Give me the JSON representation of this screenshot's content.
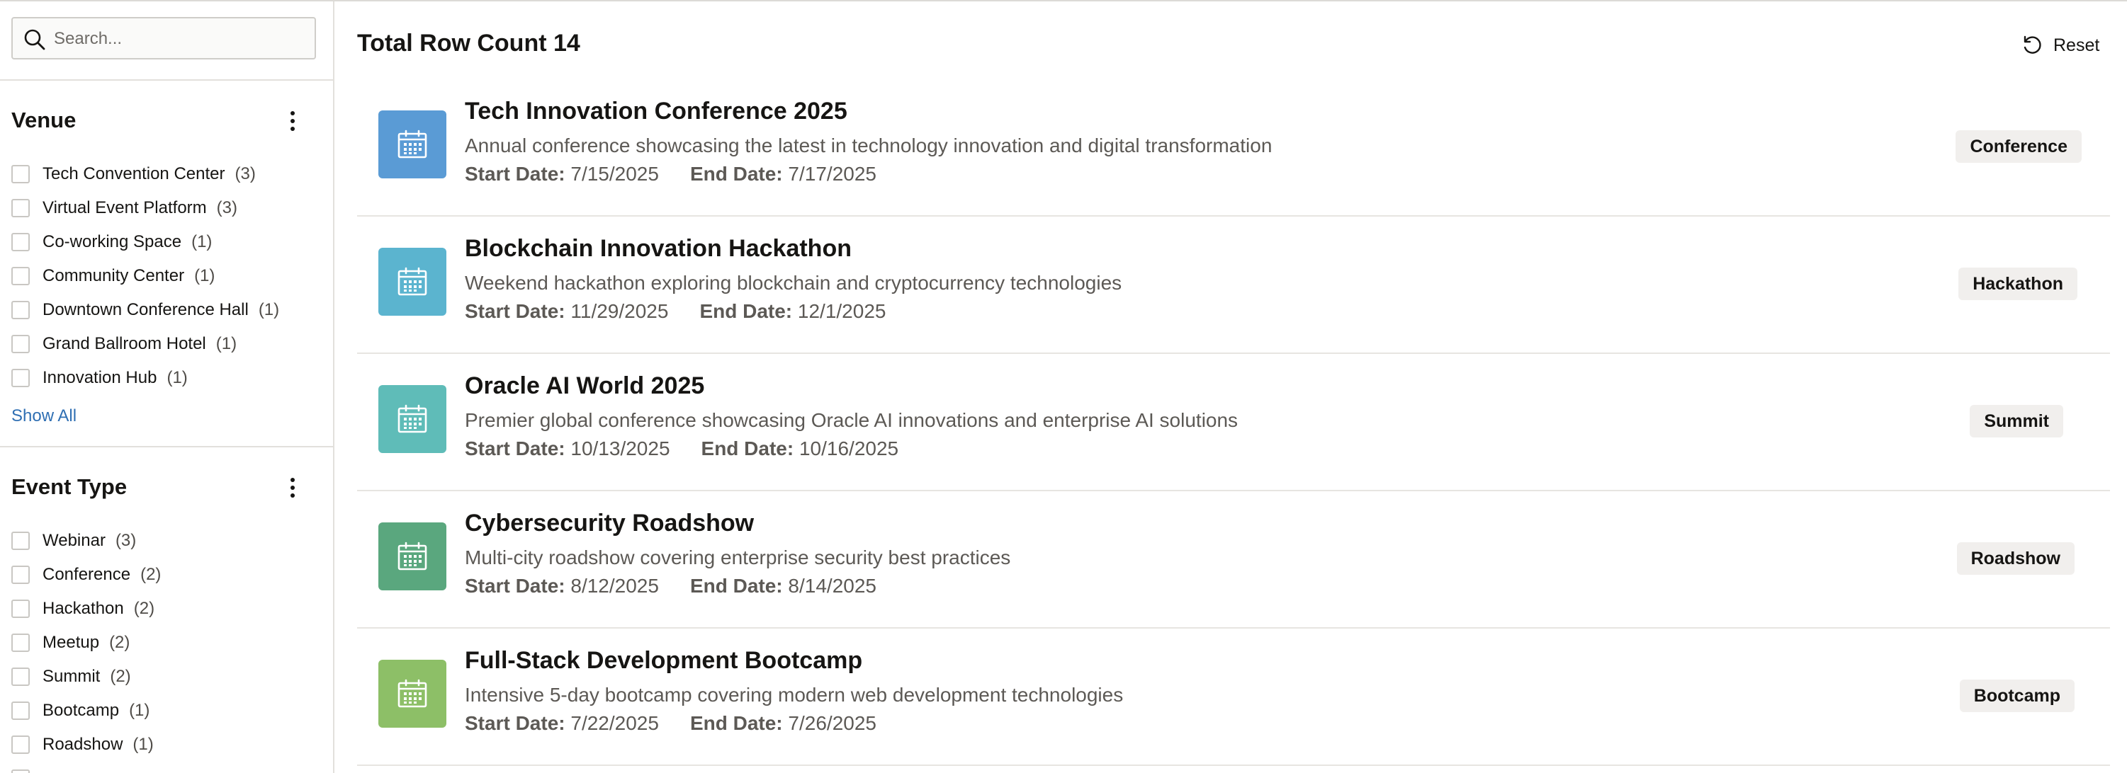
{
  "search": {
    "placeholder": "Search...",
    "value": ""
  },
  "facets": {
    "venue": {
      "title": "Venue",
      "options": [
        {
          "label": "Tech Convention Center",
          "count": "(3)"
        },
        {
          "label": "Virtual Event Platform",
          "count": "(3)"
        },
        {
          "label": "Co-working Space",
          "count": "(1)"
        },
        {
          "label": "Community Center",
          "count": "(1)"
        },
        {
          "label": "Downtown Conference Hall",
          "count": "(1)"
        },
        {
          "label": "Grand Ballroom Hotel",
          "count": "(1)"
        },
        {
          "label": "Innovation Hub",
          "count": "(1)"
        }
      ],
      "show_all": "Show All"
    },
    "event_type": {
      "title": "Event Type",
      "options": [
        {
          "label": "Webinar",
          "count": "(3)"
        },
        {
          "label": "Conference",
          "count": "(2)"
        },
        {
          "label": "Hackathon",
          "count": "(2)"
        },
        {
          "label": "Meetup",
          "count": "(2)"
        },
        {
          "label": "Summit",
          "count": "(2)"
        },
        {
          "label": "Bootcamp",
          "count": "(1)"
        },
        {
          "label": "Roadshow",
          "count": "(1)"
        }
      ]
    }
  },
  "main": {
    "total_label": "Total Row Count 14",
    "reset_label": "Reset",
    "start_label": "Start Date:",
    "end_label": "End Date:",
    "rows": [
      {
        "title": "Tech Innovation Conference 2025",
        "description": "Annual conference showcasing the latest in technology innovation and digital transformation",
        "start": "7/15/2025",
        "end": "7/17/2025",
        "type": "Conference",
        "color": "#5a9bd5",
        "icon": "calendar-icon"
      },
      {
        "title": "Blockchain Innovation Hackathon",
        "description": "Weekend hackathon exploring blockchain and cryptocurrency technologies",
        "start": "11/29/2025",
        "end": "12/1/2025",
        "type": "Hackathon",
        "color": "#5bb4cf",
        "icon": "calendar-icon"
      },
      {
        "title": "Oracle AI World 2025",
        "description": "Premier global conference showcasing Oracle AI innovations and enterprise AI solutions",
        "start": "10/13/2025",
        "end": "10/16/2025",
        "type": "Summit",
        "color": "#5fbcb8",
        "icon": "calendar-icon"
      },
      {
        "title": "Cybersecurity Roadshow",
        "description": "Multi-city roadshow covering enterprise security best practices",
        "start": "8/12/2025",
        "end": "8/14/2025",
        "type": "Roadshow",
        "color": "#5aa77e",
        "icon": "calendar-icon"
      },
      {
        "title": "Full-Stack Development Bootcamp",
        "description": "Intensive 5-day bootcamp covering modern web development technologies",
        "start": "7/22/2025",
        "end": "7/26/2025",
        "type": "Bootcamp",
        "color": "#8dbf67",
        "icon": "calendar-icon"
      }
    ]
  }
}
